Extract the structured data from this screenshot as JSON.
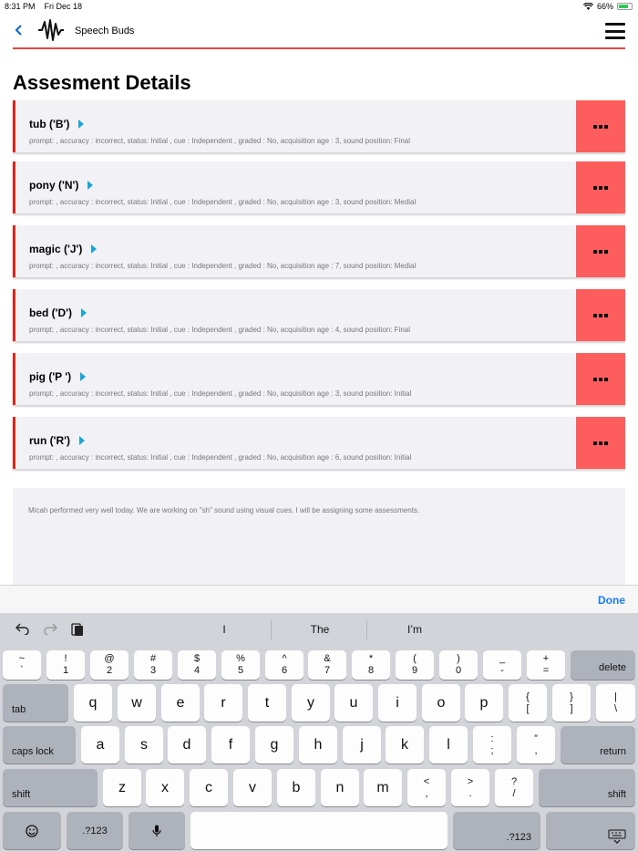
{
  "status_bar": {
    "time": "8:31 PM",
    "date": "Fri Dec 18",
    "battery": "66%"
  },
  "header": {
    "back_icon": "chevron-left-icon",
    "app_title": "Speech Buds",
    "menu_icon": "hamburger-icon"
  },
  "page_title": "Assesment Details",
  "items": [
    {
      "word": "tub ('B')",
      "details": "prompt: , accuracy : incorrect, status: Initial , cue : Independent , graded : No, acquisition age : 3, sound position: Final"
    },
    {
      "word": "pony ('N')",
      "details": "prompt: , accuracy : incorrect, status: Initial , cue : Independent , graded : No, acquisition age : 3, sound position: Medial"
    },
    {
      "word": "magic ('J')",
      "details": "prompt: , accuracy : incorrect, status: Initial , cue : Independent , graded : No, acquisition age : 7, sound position: Medial"
    },
    {
      "word": "bed ('D')",
      "details": "prompt: , accuracy : incorrect, status: Initial , cue : Independent , graded : No, acquisition age : 4, sound position: Final"
    },
    {
      "word": "pig ('P ')",
      "details": "prompt: , accuracy : incorrect, status: Initial , cue : Independent , graded : No, acquisition age : 3, sound position: Initial"
    },
    {
      "word": "run ('R')",
      "details": "prompt: , accuracy : incorrect, status: Initial , cue : Independent , graded : No, acquisition age : 6, sound position: Initial"
    }
  ],
  "notes": "Micah performed very well today. We are working on \"sh\" sound using visual cues. I will be assigning some assessments.",
  "accessory": {
    "done": "Done"
  },
  "keyboard": {
    "suggestions": [
      "I",
      "The",
      "I’m"
    ],
    "row1": [
      {
        "top": "~",
        "bottom": "`"
      },
      {
        "top": "!",
        "bottom": "1"
      },
      {
        "top": "@",
        "bottom": "2"
      },
      {
        "top": "#",
        "bottom": "3"
      },
      {
        "top": "$",
        "bottom": "4"
      },
      {
        "top": "%",
        "bottom": "5"
      },
      {
        "top": "^",
        "bottom": "6"
      },
      {
        "top": "&",
        "bottom": "7"
      },
      {
        "top": "*",
        "bottom": "8"
      },
      {
        "top": "(",
        "bottom": "9"
      },
      {
        "top": ")",
        "bottom": "0"
      },
      {
        "top": "_",
        "bottom": "-"
      },
      {
        "top": "+",
        "bottom": "="
      }
    ],
    "delete": "delete",
    "tab": "tab",
    "row2": [
      "q",
      "w",
      "e",
      "r",
      "t",
      "y",
      "u",
      "i",
      "o",
      "p"
    ],
    "row2_dual": [
      {
        "top": "{",
        "bottom": "["
      },
      {
        "top": "}",
        "bottom": "]"
      },
      {
        "top": "|",
        "bottom": "\\"
      }
    ],
    "caps_lock": "caps lock",
    "row3": [
      "a",
      "s",
      "d",
      "f",
      "g",
      "h",
      "j",
      "k",
      "l"
    ],
    "row3_dual": [
      {
        "top": ":",
        "bottom": ";"
      },
      {
        "top": "”",
        "bottom": ","
      }
    ],
    "return": "return",
    "shift": "shift",
    "row4": [
      "z",
      "x",
      "c",
      "v",
      "b",
      "n",
      "m"
    ],
    "row4_dual": [
      {
        "top": "<",
        "bottom": ","
      },
      {
        "top": ">",
        "bottom": "."
      },
      {
        "top": "?",
        "bottom": "/"
      }
    ],
    "numbers": ".?123"
  }
}
